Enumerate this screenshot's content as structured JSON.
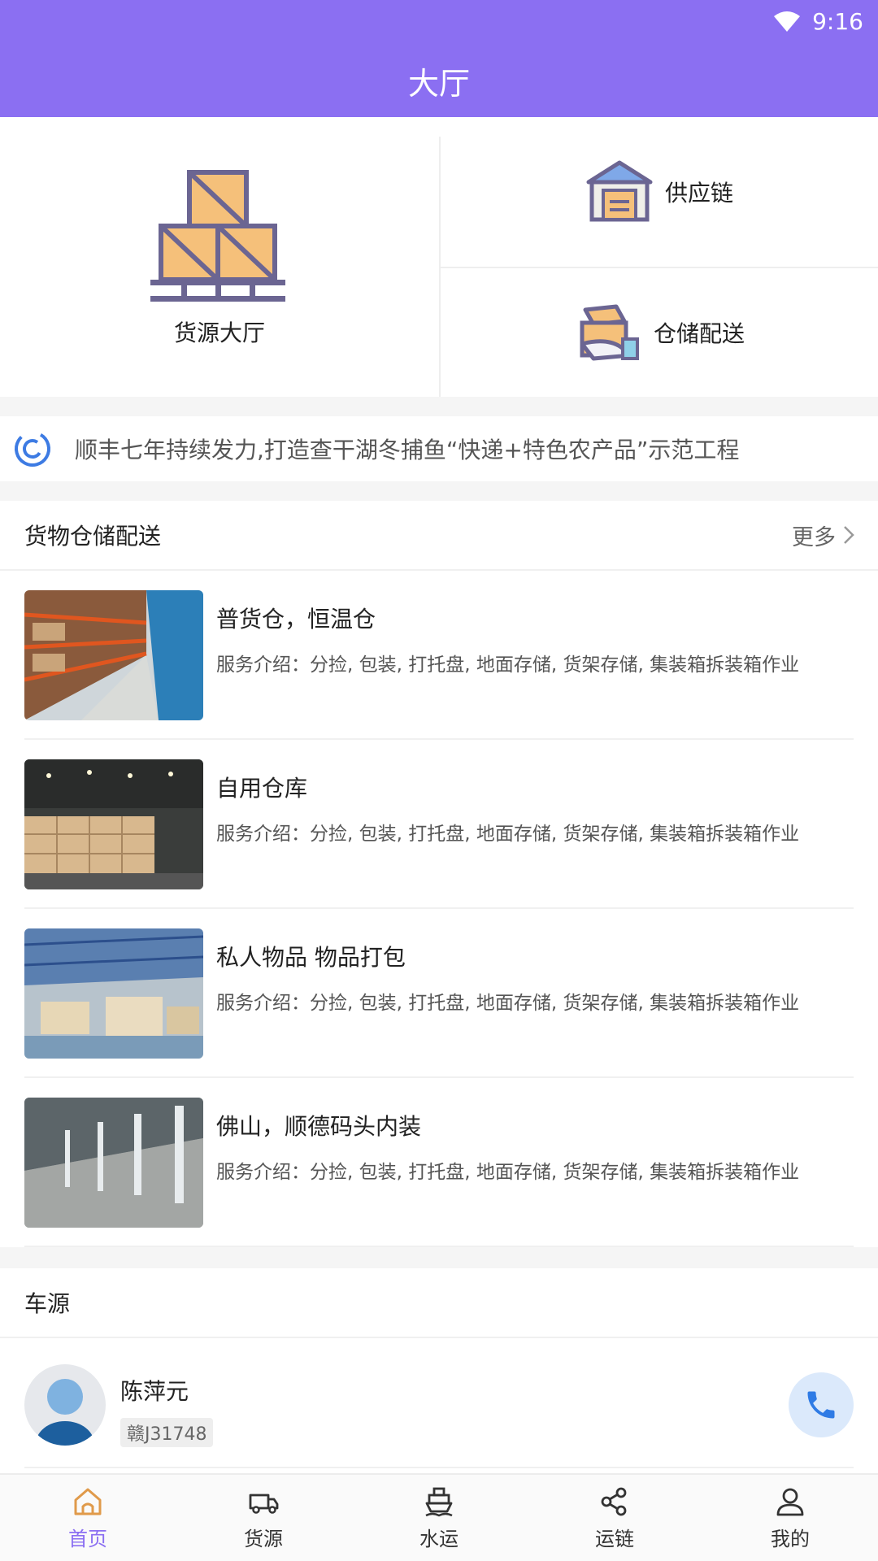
{
  "status": {
    "time": "9:16"
  },
  "header": {
    "title": "大厅"
  },
  "grid": {
    "main": {
      "label": "货源大厅",
      "icon": "boxes-pallet-icon"
    },
    "items": [
      {
        "label": "供应链",
        "icon": "warehouse-icon"
      },
      {
        "label": "仓储配送",
        "icon": "box-hand-icon"
      }
    ]
  },
  "notice": {
    "text": "顺丰七年持续发力,打造查干湖冬捕鱼“快递+特色农产品”示范工程"
  },
  "warehouse": {
    "title": "货物仓储配送",
    "more": "更多",
    "items": [
      {
        "title": "普货仓，恒温仓",
        "desc": "服务介绍：分捡, 包装, 打托盘, 地面存储, 货架存储, 集装箱拆装箱作业"
      },
      {
        "title": "自用仓库",
        "desc": "服务介绍：分捡, 包装, 打托盘, 地面存储, 货架存储, 集装箱拆装箱作业"
      },
      {
        "title": "私人物品 物品打包",
        "desc": "服务介绍：分捡, 包装, 打托盘, 地面存储, 货架存储, 集装箱拆装箱作业"
      },
      {
        "title": "佛山，顺德码头内装",
        "desc": "服务介绍：分捡, 包装, 打托盘, 地面存储, 货架存储, 集装箱拆装箱作业"
      }
    ]
  },
  "vehicles": {
    "title": "车源",
    "items": [
      {
        "name": "陈萍元",
        "plate": "赣J31748"
      }
    ]
  },
  "tabs": [
    {
      "label": "首页",
      "icon": "home-icon",
      "active": true
    },
    {
      "label": "货源",
      "icon": "truck-icon"
    },
    {
      "label": "水运",
      "icon": "ship-icon"
    },
    {
      "label": "运链",
      "icon": "share-icon"
    },
    {
      "label": "我的",
      "icon": "user-icon"
    }
  ],
  "colors": {
    "accent": "#8b6ff2",
    "call_bg": "#dbe9fb",
    "call_icon": "#2f7be5"
  }
}
